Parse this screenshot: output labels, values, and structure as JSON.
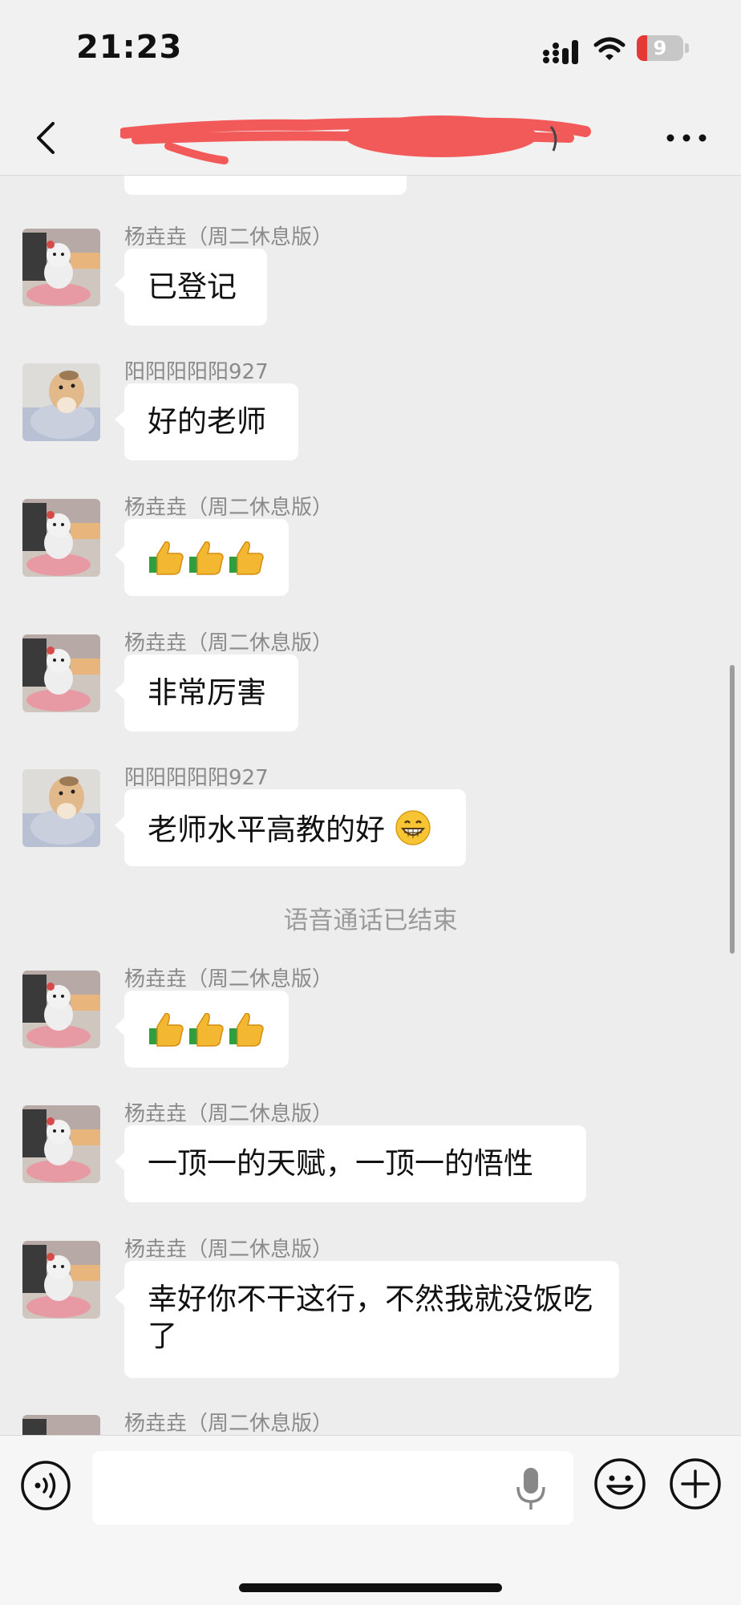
{
  "status_bar": {
    "time": "21:23",
    "battery_level": "9"
  },
  "nav": {
    "title": ""
  },
  "colors": {
    "background": "#ededed",
    "bubble": "#ffffff",
    "sender": "#8a8a8a",
    "battery_low": "#e53935"
  },
  "messages": [
    {
      "sender": "杨垚垚（周二休息版）",
      "text": "已登记"
    },
    {
      "sender": "阳阳阳阳阳927",
      "text": "好的老师"
    },
    {
      "sender": "杨垚垚（周二休息版）",
      "text": "👍👍👍"
    },
    {
      "sender": "杨垚垚（周二休息版）",
      "text": "非常厉害"
    },
    {
      "sender": "阳阳阳阳阳927",
      "text": "老师水平高教的好"
    },
    {
      "system": "语音通话已结束"
    },
    {
      "sender": "杨垚垚（周二休息版）",
      "text": "👍👍👍"
    },
    {
      "sender": "杨垚垚（周二休息版）",
      "text": "一顶一的天赋，一顶一的悟性"
    },
    {
      "sender": "杨垚垚（周二休息版）",
      "text": "幸好你不干这行，不然我就没饭吃了"
    },
    {
      "sender": "杨垚垚（周二休息版）"
    }
  ],
  "input": {
    "value": "",
    "placeholder": ""
  },
  "icons": {
    "back": "chevron-left-icon",
    "more": "more-dots-icon",
    "voice": "voice-icon",
    "mic": "mic-icon",
    "emoji": "emoji-icon",
    "plus": "plus-icon"
  }
}
